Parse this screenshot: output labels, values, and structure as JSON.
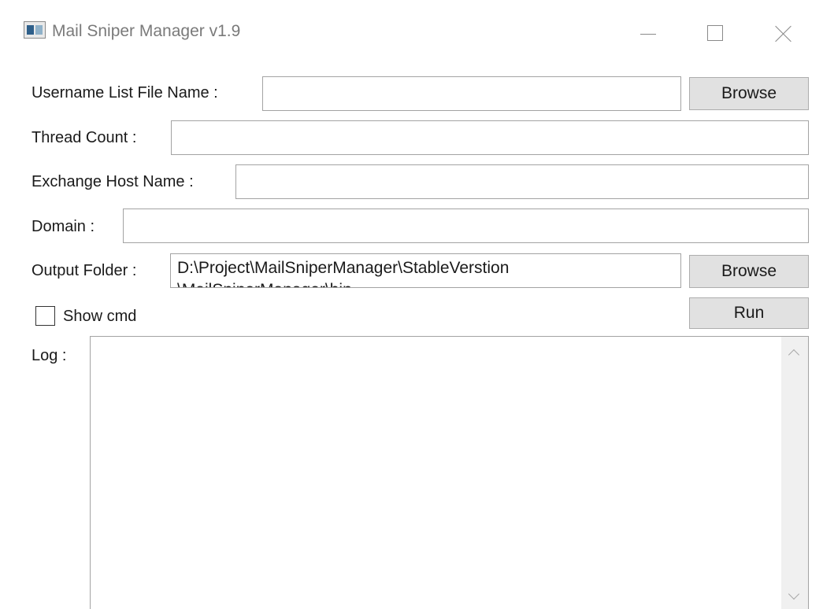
{
  "window": {
    "title": "Mail Sniper Manager v1.9",
    "icons": [
      "app-window-icon",
      "minimize-icon",
      "maximize-icon",
      "close-icon"
    ]
  },
  "form": {
    "username_label": "Username List File Name :",
    "username_value": "",
    "browse_label": "Browse",
    "thread_label": "Thread Count :",
    "thread_value": "",
    "host_label": "Exchange Host Name :",
    "host_value": "",
    "domain_label": "Domain :",
    "domain_value": "",
    "output_label": "Output Folder :",
    "output_value": "D:\\Project\\MailSniperManager\\StableVerstion",
    "output_value_line2": "\\MailSniperManager\\bin",
    "output_browse_label": "Browse",
    "show_cmd_label": "Show cmd",
    "show_cmd_checked": false,
    "run_label": "Run",
    "log_label": "Log :",
    "log_value": ""
  },
  "colors": {
    "button_bg": "#e1e1e1",
    "border": "#a3a3a3",
    "title_text": "#7a7a7a"
  }
}
